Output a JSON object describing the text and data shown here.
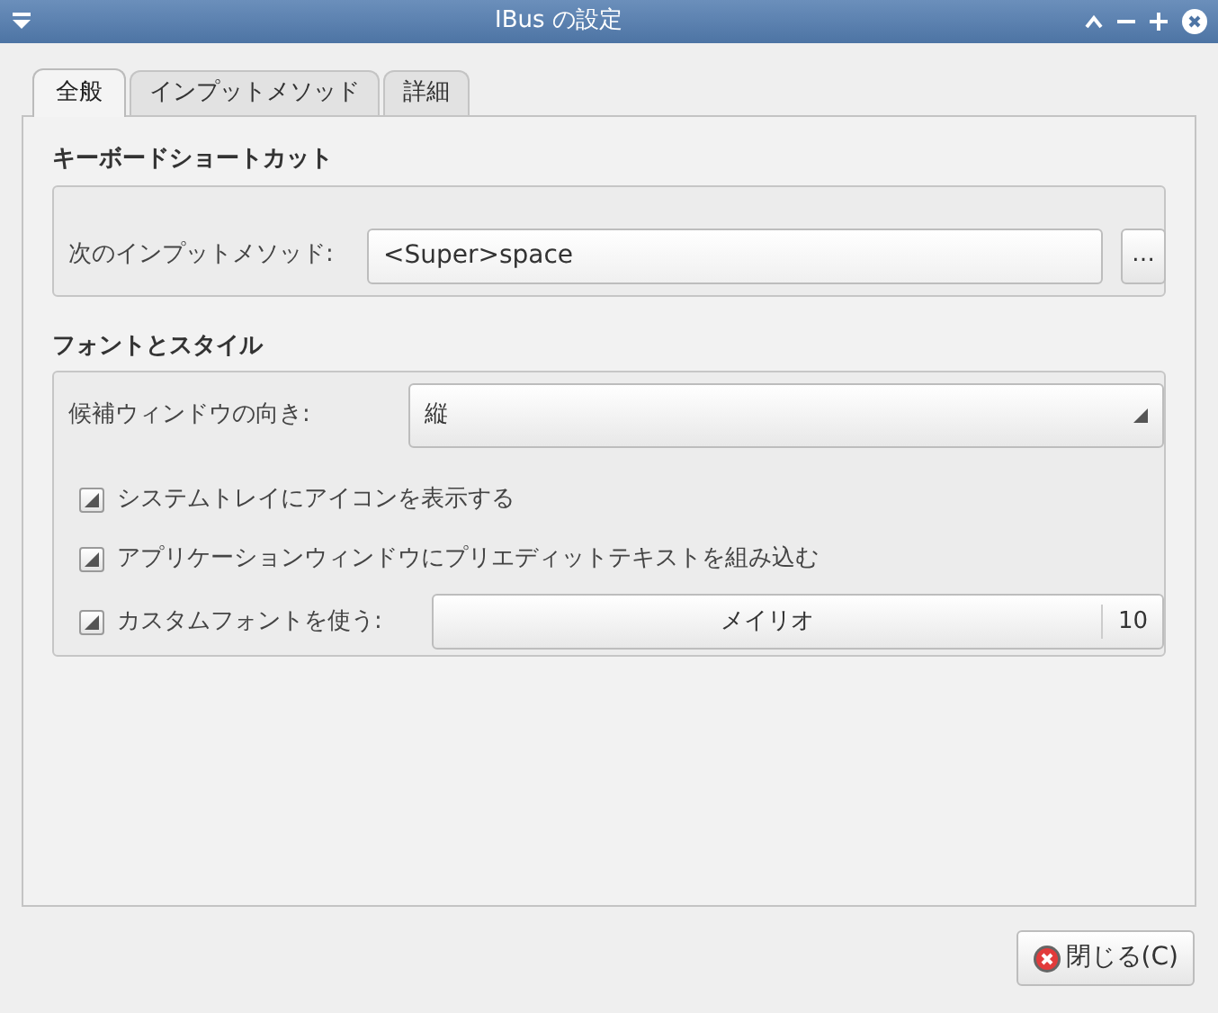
{
  "window": {
    "title": "IBus の設定"
  },
  "tabs": [
    {
      "label": "全般",
      "selected": true
    },
    {
      "label": "インプットメソッド",
      "selected": false
    },
    {
      "label": "詳細",
      "selected": false
    }
  ],
  "keyboard_shortcuts": {
    "heading": "キーボードショートカット",
    "label": "次のインプットメソッド:",
    "value": "<Super>space",
    "browse_button": "…"
  },
  "font_and_style": {
    "heading": "フォントとスタイル",
    "orientation_label": "候補ウィンドウの向き:",
    "orientation_value": "縦",
    "checkboxes": [
      {
        "label": "システムトレイにアイコンを表示する",
        "checked": true
      },
      {
        "label": "アプリケーションウィンドウにプリエディットテキストを組み込む",
        "checked": true
      },
      {
        "label": "カスタムフォントを使う:",
        "checked": true
      }
    ],
    "font_name": "メイリオ",
    "font_size": "10"
  },
  "close_button": "閉じる(C)"
}
